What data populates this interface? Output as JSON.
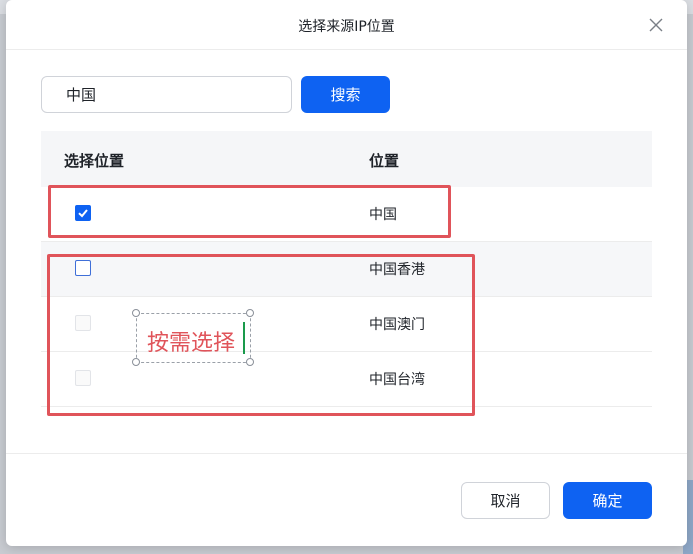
{
  "dialog": {
    "title": "选择来源IP位置",
    "close_icon": "close-icon"
  },
  "search": {
    "value": "中国",
    "button_label": "搜索"
  },
  "table": {
    "columns": [
      "选择位置",
      "位置"
    ],
    "rows": [
      {
        "location": "中国",
        "checked": true
      },
      {
        "location": "中国香港",
        "checked": false
      },
      {
        "location": "中国澳门",
        "checked": false
      },
      {
        "location": "中国台湾",
        "checked": false
      }
    ]
  },
  "annotation": {
    "text": "按需选择"
  },
  "footer": {
    "cancel_label": "取消",
    "ok_label": "确定"
  },
  "colors": {
    "primary": "#0e62f2",
    "annotation": "#e0545a"
  }
}
